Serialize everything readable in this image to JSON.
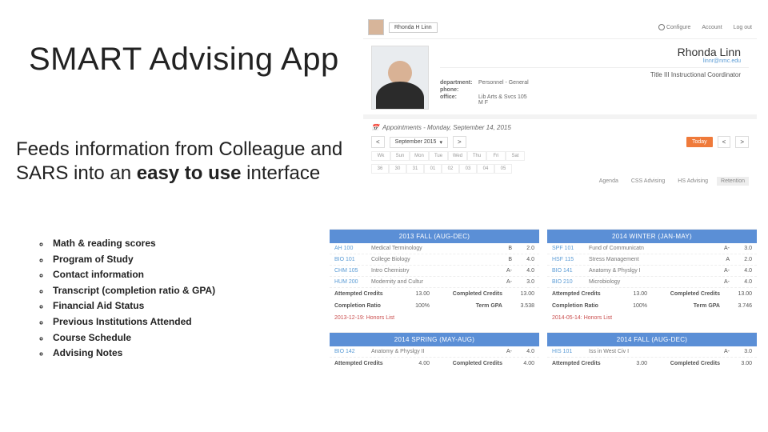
{
  "title": "SMART Advising App",
  "subtitle_pre": "Feeds information from Colleague and SARS into an ",
  "subtitle_bold": "easy to use",
  "subtitle_post": " interface",
  "bullets": [
    "Math & reading scores",
    "Program of Study",
    "Contact information",
    "Transcript (completion ratio & GPA)",
    "Financial Aid Status",
    "Previous Institutions Attended",
    "Course Schedule",
    "Advising Notes"
  ],
  "app": {
    "topbar": {
      "search_value": "Rhonda H Linn",
      "links": {
        "configure": "Configure",
        "account": "Account",
        "logout": "Log out"
      }
    },
    "profile": {
      "name": "Rhonda Linn",
      "handle": "linnr@nmc.edu",
      "role": "Title III Instructional Coordinator",
      "department_k": "department:",
      "department_v": "Personnel - General",
      "phone_k": "phone:",
      "phone_v": "",
      "office_k": "office:",
      "office_v": "Lib Arts & Svcs 105\nM F"
    },
    "appointments": {
      "header": "Appointments - Monday, September 14, 2015",
      "month_label": "September 2015",
      "today_label": "Today",
      "week_label": "Wk",
      "days": [
        "Sun",
        "Mon",
        "Tue",
        "Wed",
        "Thu",
        "Fri",
        "Sat"
      ],
      "daynums": [
        "30",
        "31",
        "01",
        "02",
        "03",
        "04",
        "05"
      ],
      "tabs": [
        "Agenda",
        "CSS Advising",
        "HS Advising",
        "Retention"
      ],
      "active_tab": 3
    },
    "terms": [
      {
        "bar": "2013 FALL (AUG-DEC)",
        "rows": [
          {
            "code": "AH 100",
            "name": "Medical Terminology",
            "gr": "B",
            "cr": "2.0"
          },
          {
            "code": "BIO 101",
            "name": "College Biology",
            "gr": "B",
            "cr": "4.0"
          },
          {
            "code": "CHM 105",
            "name": "Intro Chemistry",
            "gr": "A-",
            "cr": "4.0"
          },
          {
            "code": "HUM 200",
            "name": "Modernity and Cultur",
            "gr": "A-",
            "cr": "3.0"
          }
        ],
        "summary": [
          {
            "lbl": "Attempted Credits",
            "val": "13.00",
            "lbl2": "Completed Credits",
            "val2": "13.00"
          },
          {
            "lbl": "Completion Ratio",
            "val": "100%",
            "lbl2": "Term GPA",
            "val2": "3.538"
          }
        ],
        "honors": "2013-12-19: Honors List"
      },
      {
        "bar": "2014 WINTER (JAN-MAY)",
        "rows": [
          {
            "code": "SPF 101",
            "name": "Fund of Communicatn",
            "gr": "A-",
            "cr": "3.0"
          },
          {
            "code": "HSF 115",
            "name": "Stress Management",
            "gr": "A",
            "cr": "2.0"
          },
          {
            "code": "BIO 141",
            "name": "Anatomy & Physlgy I",
            "gr": "A-",
            "cr": "4.0"
          },
          {
            "code": "BIO 210",
            "name": "Microbiology",
            "gr": "A-",
            "cr": "4.0"
          }
        ],
        "summary": [
          {
            "lbl": "Attempted Credits",
            "val": "13.00",
            "lbl2": "Completed Credits",
            "val2": "13.00"
          },
          {
            "lbl": "Completion Ratio",
            "val": "100%",
            "lbl2": "Term GPA",
            "val2": "3.746"
          }
        ],
        "honors": "2014-05-14: Honors List"
      },
      {
        "bar": "2014 SPRING (MAY-AUG)",
        "rows": [
          {
            "code": "BIO 142",
            "name": "Anatomy & Physlgy II",
            "gr": "A-",
            "cr": "4.0"
          }
        ],
        "summary": [
          {
            "lbl": "Attempted Credits",
            "val": "4.00",
            "lbl2": "Completed Credits",
            "val2": "4.00"
          }
        ],
        "honors": ""
      },
      {
        "bar": "2014 FALL (AUG-DEC)",
        "rows": [
          {
            "code": "HIS 101",
            "name": "Iss in West Civ I",
            "gr": "A-",
            "cr": "3.0"
          }
        ],
        "summary": [
          {
            "lbl": "Attempted Credits",
            "val": "3.00",
            "lbl2": "Completed Credits",
            "val2": "3.00"
          }
        ],
        "honors": ""
      }
    ]
  }
}
